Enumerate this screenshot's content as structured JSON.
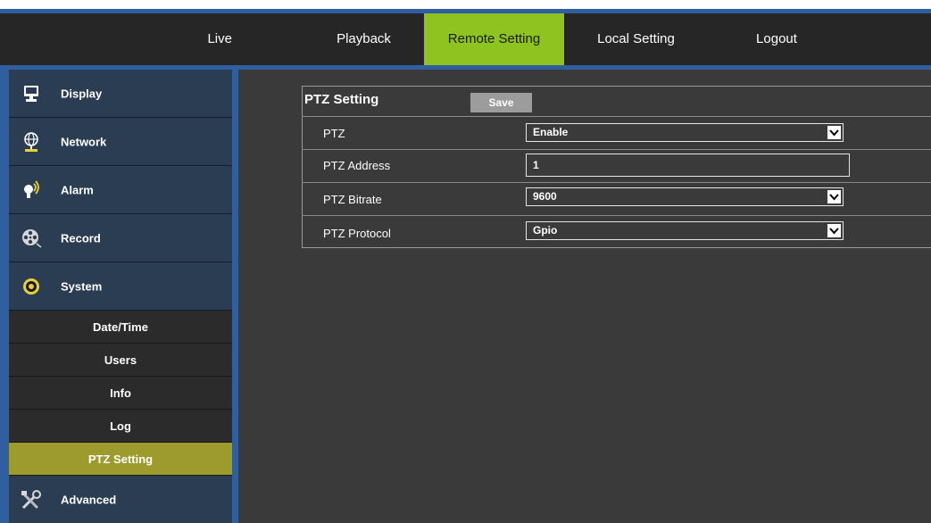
{
  "nav": {
    "items": [
      {
        "label": "Live"
      },
      {
        "label": "Playback"
      },
      {
        "label": "Remote Setting"
      },
      {
        "label": "Local Setting"
      },
      {
        "label": "Logout"
      }
    ],
    "active": "Remote Setting"
  },
  "sidebar": {
    "categories": [
      {
        "label": "Display",
        "icon": "monitor-icon"
      },
      {
        "label": "Network",
        "icon": "globe-network-icon"
      },
      {
        "label": "Alarm",
        "icon": "alarm-bulb-icon"
      },
      {
        "label": "Record",
        "icon": "film-reel-icon"
      },
      {
        "label": "System",
        "icon": "system-gear-icon"
      },
      {
        "label": "Advanced",
        "icon": "tools-icon"
      }
    ],
    "system_subitems": [
      {
        "label": "Date/Time"
      },
      {
        "label": "Users"
      },
      {
        "label": "Info"
      },
      {
        "label": "Log"
      },
      {
        "label": "PTZ Setting"
      }
    ],
    "active_subitem": "PTZ Setting"
  },
  "main": {
    "title": "PTZ Setting",
    "save_label": "Save",
    "rows": [
      {
        "label": "PTZ",
        "value": "Enable",
        "type": "select"
      },
      {
        "label": "PTZ Address",
        "value": "1",
        "type": "input"
      },
      {
        "label": "PTZ Bitrate",
        "value": "9600",
        "type": "select"
      },
      {
        "label": "PTZ Protocol",
        "value": "Gpio",
        "type": "select"
      }
    ]
  },
  "colors": {
    "accent_active_tab": "#8fc31f",
    "active_subitem": "#9d9a2e",
    "border_blue": "#2f5f9e",
    "nav_bg": "#262626",
    "content_bg": "#3a3a3a"
  }
}
